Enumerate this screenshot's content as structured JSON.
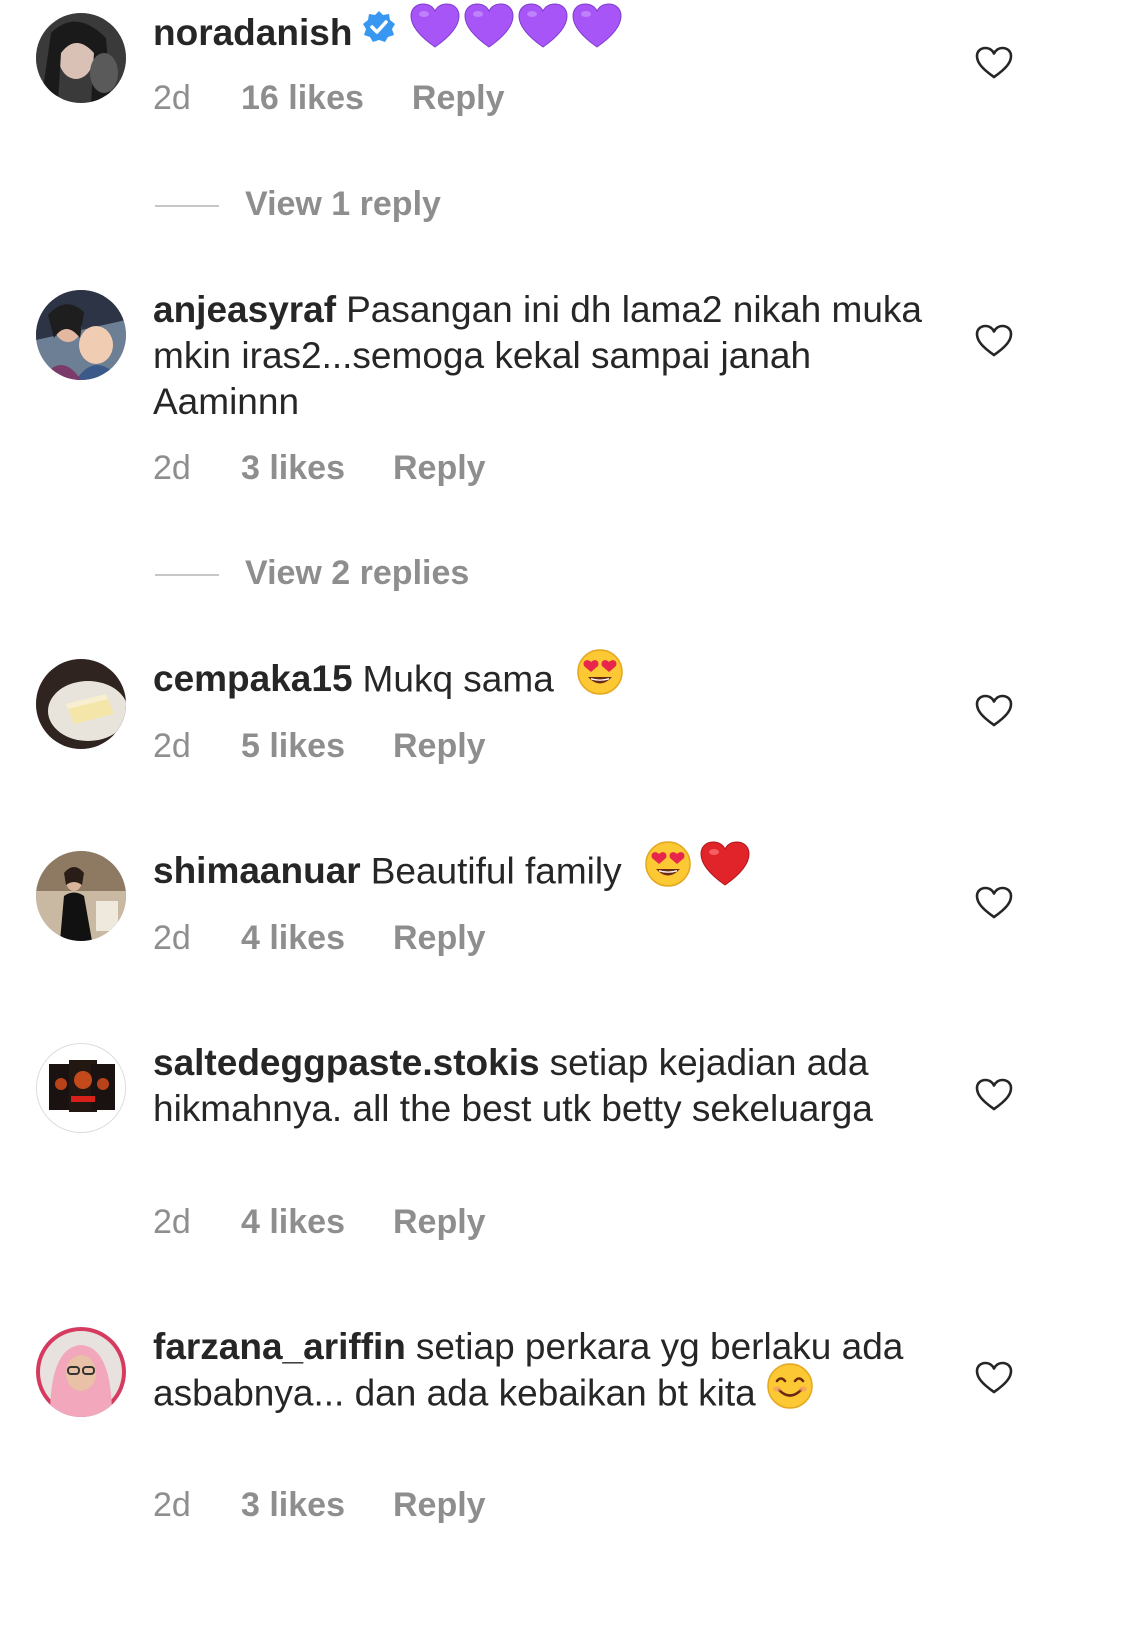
{
  "comments": [
    {
      "username": "noradanish",
      "verified": true,
      "text": "",
      "emojis": [
        "purple-heart",
        "purple-heart",
        "purple-heart",
        "purple-heart"
      ],
      "time": "2d",
      "likes": "16 likes",
      "reply": "Reply"
    },
    {
      "username": "anjeasyraf",
      "verified": false,
      "text": "Pasangan ini dh lama2 nikah muka mkin iras2...semoga kekal sampai janah Aaminnn",
      "emojis": [],
      "time": "2d",
      "likes": "3 likes",
      "reply": "Reply"
    },
    {
      "username": "cempaka15",
      "verified": false,
      "text": "Mukq sama",
      "emojis": [
        "heart-eyes"
      ],
      "time": "2d",
      "likes": "5 likes",
      "reply": "Reply"
    },
    {
      "username": "shimaanuar",
      "verified": false,
      "text": "Beautiful family",
      "emojis": [
        "heart-eyes",
        "red-heart"
      ],
      "time": "2d",
      "likes": "4 likes",
      "reply": "Reply"
    },
    {
      "username": "saltedeggpaste.stokis",
      "verified": false,
      "text": "setiap kejadian ada hikmahnya. all the best utk betty sekeluarga",
      "emojis": [],
      "time": "2d",
      "likes": "4 likes",
      "reply": "Reply"
    },
    {
      "username": "farzana_ariffin",
      "verified": false,
      "text": "setiap perkara yg berlaku ada asbabnya... dan ada kebaikan bt kita",
      "emojis": [
        "smiling-face"
      ],
      "time": "2d",
      "likes": "3 likes",
      "reply": "Reply"
    }
  ],
  "view_replies": [
    "View 1 reply",
    "View 2 replies"
  ],
  "colors": {
    "text": "#262626",
    "secondary": "#8e8e8e",
    "verified": "#3897f0",
    "purple_heart": "#a855f7",
    "red_heart": "#e0242a"
  }
}
